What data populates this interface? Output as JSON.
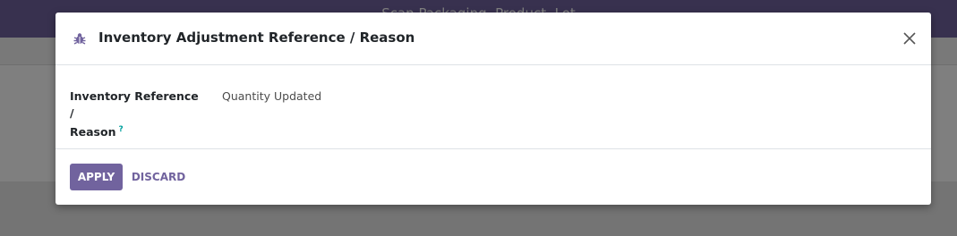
{
  "background": {
    "topbar_title": "Scan Packaging, Product, Lot"
  },
  "dialog": {
    "icon": "bug-icon",
    "title": "Inventory Adjustment Reference / Reason",
    "close_icon": "close-icon",
    "field": {
      "label_line1": "Inventory Reference /",
      "label_line2": "Reason",
      "help_marker": "?",
      "value": "Quantity Updated"
    },
    "buttons": {
      "apply": "APPLY",
      "discard": "DISCARD"
    }
  },
  "colors": {
    "brand": "#71639e",
    "help_tip": "#00a09d"
  }
}
